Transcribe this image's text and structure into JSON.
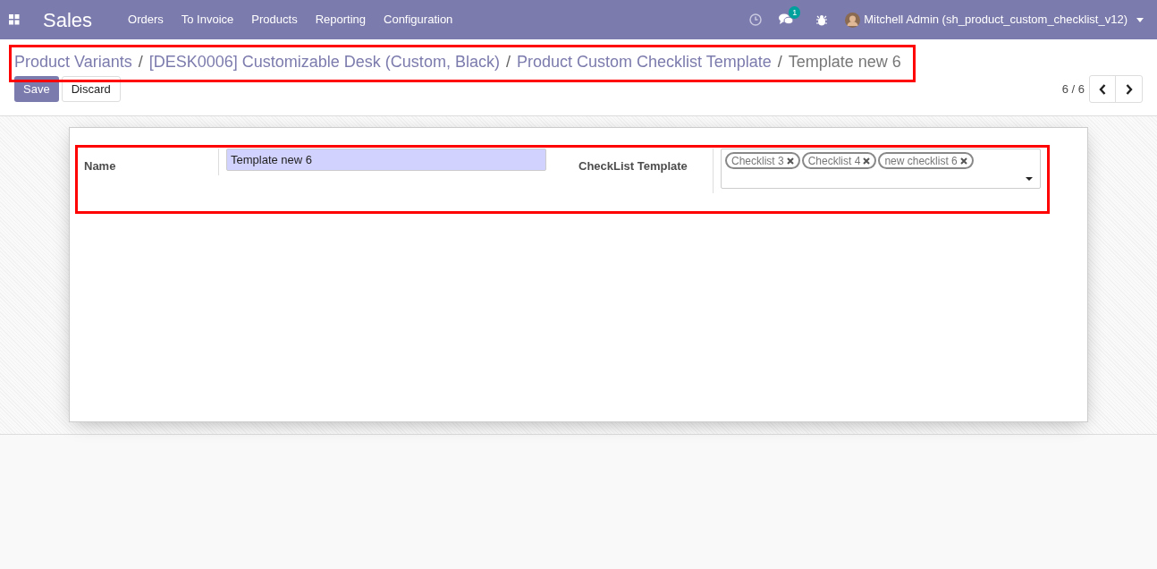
{
  "navbar": {
    "app_name": "Sales",
    "menu": [
      "Orders",
      "To Invoice",
      "Products",
      "Reporting",
      "Configuration"
    ],
    "message_count": "1",
    "user": "Mitchell Admin (sh_product_custom_checklist_v12)"
  },
  "breadcrumb": [
    {
      "label": "Product Variants",
      "current": false
    },
    {
      "label": "[DESK0006] Customizable Desk (Custom, Black)",
      "current": false
    },
    {
      "label": "Product Custom Checklist Template",
      "current": false
    },
    {
      "label": "Template new 6",
      "current": true
    }
  ],
  "separator": "/",
  "buttons": {
    "save": "Save",
    "discard": "Discard"
  },
  "pager": "6 / 6",
  "form": {
    "name_label": "Name",
    "name_value": "Template new 6",
    "checklist_label": "CheckList Template",
    "tags": [
      "Checklist 3",
      "Checklist 4",
      "new checklist 6"
    ]
  }
}
